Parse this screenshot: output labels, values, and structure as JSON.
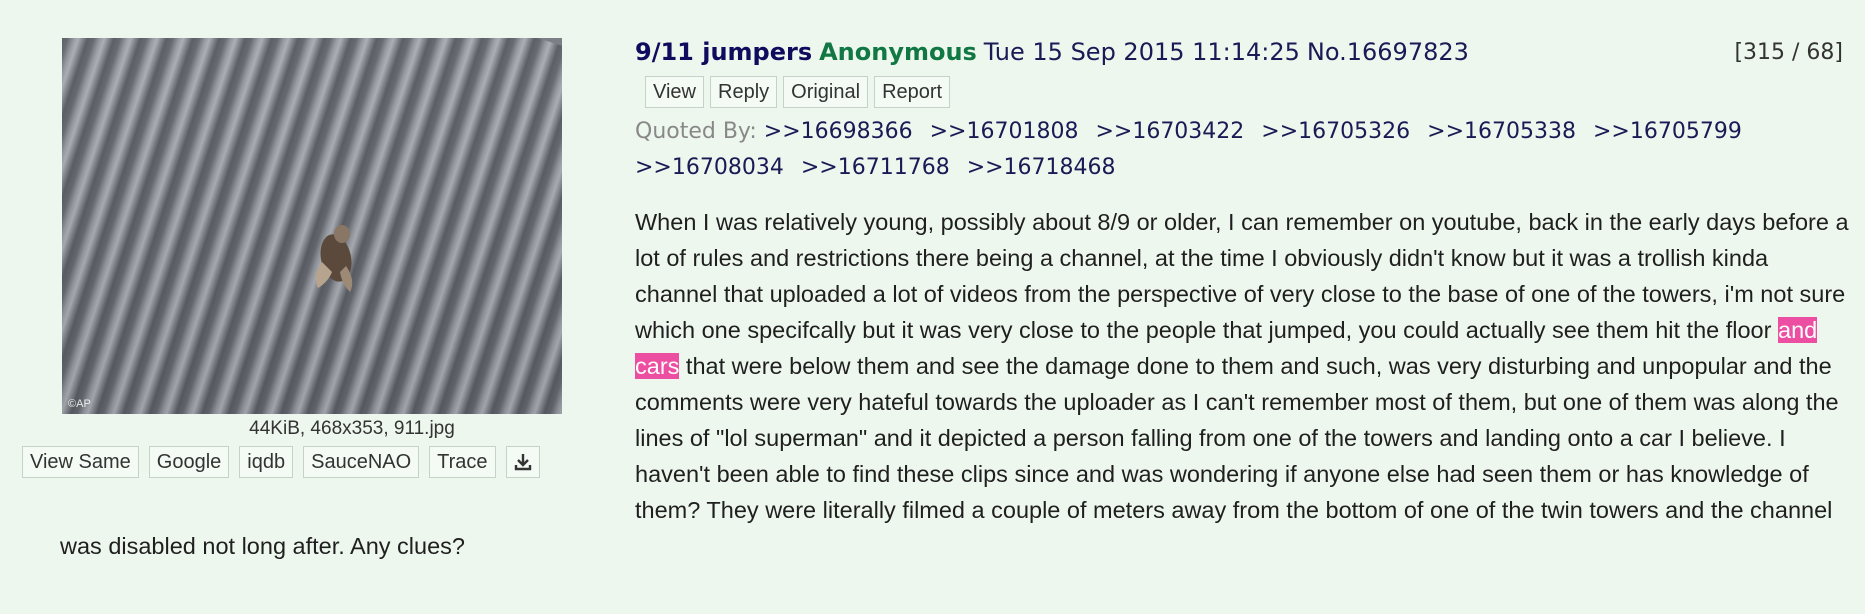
{
  "thumbnail": {
    "watermark": "©AP"
  },
  "file_info": "44KiB, 468x353, 911.jpg",
  "image_actions": [
    {
      "label": "View Same"
    },
    {
      "label": "Google"
    },
    {
      "label": "iqdb"
    },
    {
      "label": "SauceNAO"
    },
    {
      "label": "Trace"
    }
  ],
  "download_icon": "download-icon",
  "post": {
    "subject": "9/11 jumpers",
    "name": "Anonymous",
    "date": "Tue 15 Sep 2015 11:14:25",
    "number": "No.16697823",
    "counts": "[315 / 68]"
  },
  "post_actions": [
    {
      "label": "View"
    },
    {
      "label": "Reply"
    },
    {
      "label": "Original"
    },
    {
      "label": "Report"
    }
  ],
  "quoted_by": {
    "label": "Quoted By:",
    "links": [
      ">>16698366",
      ">>16701808",
      ">>16703422",
      ">>16705326",
      ">>16705338",
      ">>16705799",
      ">>16708034",
      ">>16711768",
      ">>16718468"
    ]
  },
  "comment": {
    "before": "When I was relatively young, possibly about 8/9 or older, I can remember on youtube, back in the early days before a lot of rules and restrictions there being a channel, at the time I obviously didn't know but it was a trollish kinda channel that uploaded a lot of videos from the perspective of very close to the base of one of the towers, i'm not sure which one specifcally but it was very close to the people that jumped, you could actually see them hit the floor ",
    "highlight": "and cars",
    "after": " that were below them and see the damage done to them and such, was very disturbing and unpopular and the comments were very hateful towards the uploader as I can't remember most of them, but one of them was along the lines of \"lol superman\" and it depicted a person falling from one of the towers and landing onto a car I believe. I haven't been able to find these clips since and was wondering if anyone else had seen them or has knowledge of them? They were literally filmed a couple of meters away from the bottom of one of the twin towers and the channel was disabled not long after. Any clues?"
  },
  "colors": {
    "background": "#eef7ee",
    "subject": "#0f0c5d",
    "name": "#117743",
    "highlight": "#ec4ea2"
  }
}
